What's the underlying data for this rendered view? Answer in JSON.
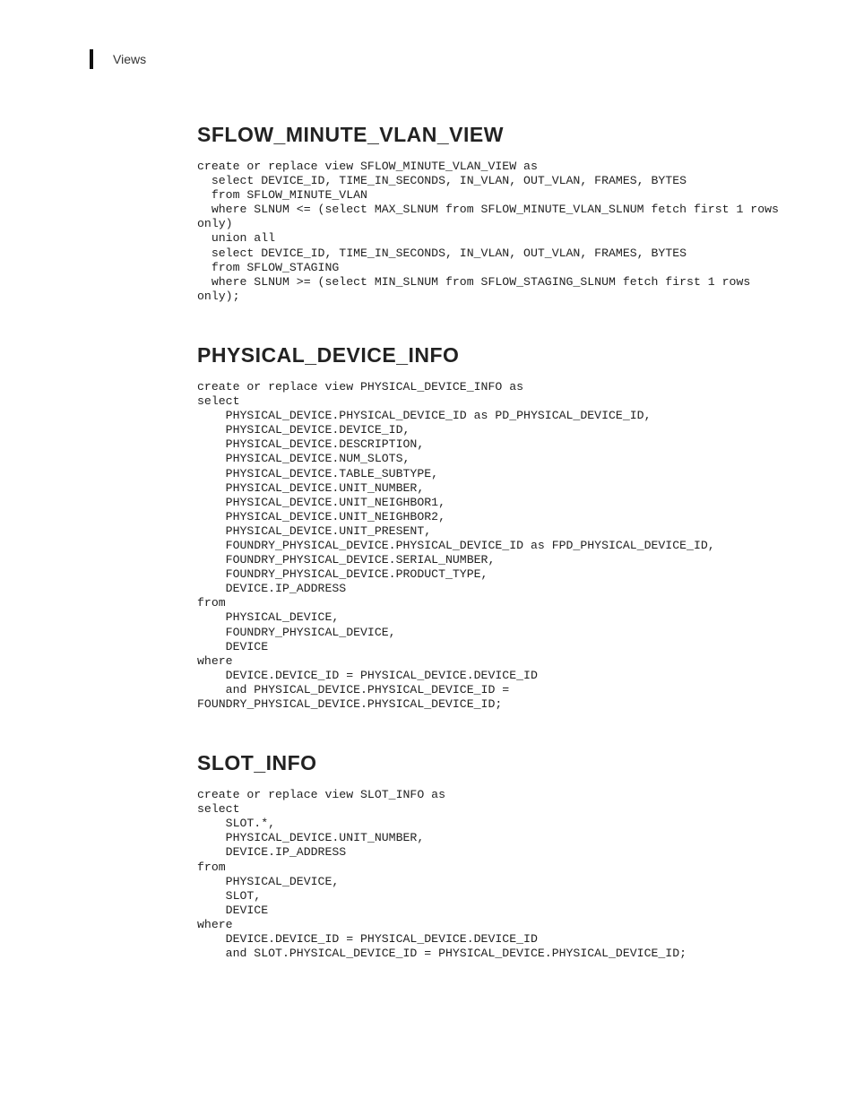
{
  "header": {
    "label": "Views"
  },
  "sections": {
    "s1": {
      "title": "SFLOW_MINUTE_VLAN_VIEW",
      "code": "create or replace view SFLOW_MINUTE_VLAN_VIEW as\n  select DEVICE_ID, TIME_IN_SECONDS, IN_VLAN, OUT_VLAN, FRAMES, BYTES\n  from SFLOW_MINUTE_VLAN\n  where SLNUM <= (select MAX_SLNUM from SFLOW_MINUTE_VLAN_SLNUM fetch first 1 rows\nonly)\n  union all\n  select DEVICE_ID, TIME_IN_SECONDS, IN_VLAN, OUT_VLAN, FRAMES, BYTES\n  from SFLOW_STAGING\n  where SLNUM >= (select MIN_SLNUM from SFLOW_STAGING_SLNUM fetch first 1 rows\nonly);"
    },
    "s2": {
      "title": "PHYSICAL_DEVICE_INFO",
      "code": "create or replace view PHYSICAL_DEVICE_INFO as\nselect\n    PHYSICAL_DEVICE.PHYSICAL_DEVICE_ID as PD_PHYSICAL_DEVICE_ID,\n    PHYSICAL_DEVICE.DEVICE_ID,\n    PHYSICAL_DEVICE.DESCRIPTION,\n    PHYSICAL_DEVICE.NUM_SLOTS,\n    PHYSICAL_DEVICE.TABLE_SUBTYPE,\n    PHYSICAL_DEVICE.UNIT_NUMBER,\n    PHYSICAL_DEVICE.UNIT_NEIGHBOR1,\n    PHYSICAL_DEVICE.UNIT_NEIGHBOR2,\n    PHYSICAL_DEVICE.UNIT_PRESENT,\n    FOUNDRY_PHYSICAL_DEVICE.PHYSICAL_DEVICE_ID as FPD_PHYSICAL_DEVICE_ID,\n    FOUNDRY_PHYSICAL_DEVICE.SERIAL_NUMBER,\n    FOUNDRY_PHYSICAL_DEVICE.PRODUCT_TYPE,\n    DEVICE.IP_ADDRESS\nfrom\n    PHYSICAL_DEVICE,\n    FOUNDRY_PHYSICAL_DEVICE,\n    DEVICE\nwhere\n    DEVICE.DEVICE_ID = PHYSICAL_DEVICE.DEVICE_ID\n    and PHYSICAL_DEVICE.PHYSICAL_DEVICE_ID =\nFOUNDRY_PHYSICAL_DEVICE.PHYSICAL_DEVICE_ID;"
    },
    "s3": {
      "title": "SLOT_INFO",
      "code": "create or replace view SLOT_INFO as\nselect\n    SLOT.*,\n    PHYSICAL_DEVICE.UNIT_NUMBER,\n    DEVICE.IP_ADDRESS\nfrom\n    PHYSICAL_DEVICE,\n    SLOT,\n    DEVICE\nwhere\n    DEVICE.DEVICE_ID = PHYSICAL_DEVICE.DEVICE_ID\n    and SLOT.PHYSICAL_DEVICE_ID = PHYSICAL_DEVICE.PHYSICAL_DEVICE_ID;"
    }
  }
}
